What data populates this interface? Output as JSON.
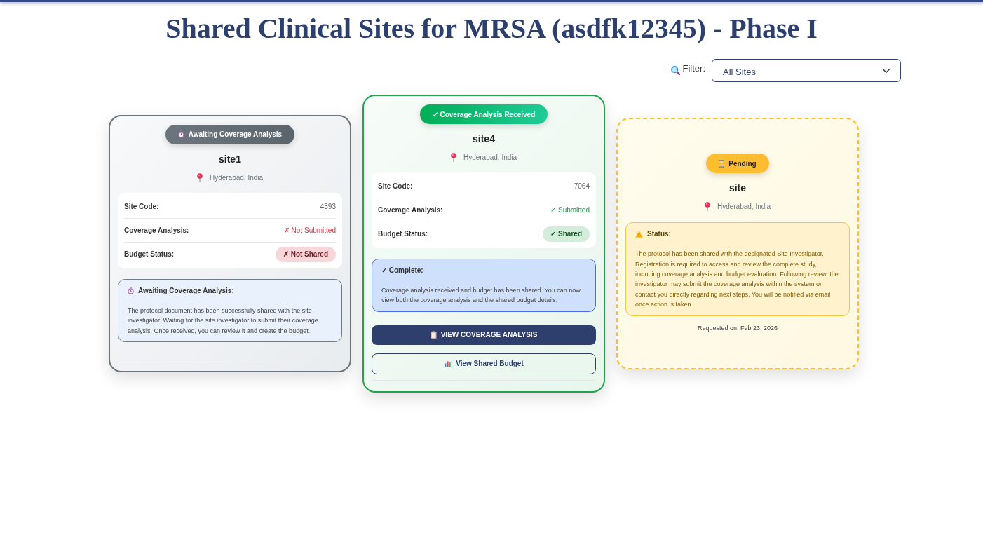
{
  "page_title": "Shared Clinical Sites for MRSA (asdfk12345) - Phase I",
  "filter": {
    "label": "Filter:",
    "value": "All Sites"
  },
  "sites": [
    {
      "kind": "awaiting",
      "status_badge": "Awaiting Coverage Analysis",
      "name": "site1",
      "location": "Hyderabad, India",
      "details": [
        {
          "label": "Site Code:",
          "value": "4393",
          "kind": "plain"
        },
        {
          "label": "Coverage Analysis:",
          "value": "✗ Not Submitted",
          "kind": "negative"
        },
        {
          "label": "Budget Status:",
          "value": "✗ Not Shared",
          "kind": "negative-pill"
        }
      ],
      "note": {
        "title": "Awaiting Coverage Analysis:",
        "text": "The protocol document has been successfully shared with the site investigator. Waiting for the site investigator to submit their coverage analysis. Once received, you can review it and create the budget."
      }
    },
    {
      "kind": "received",
      "status_badge": "✓ Coverage Analysis Received",
      "name": "site4",
      "location": "Hyderabad, India",
      "details": [
        {
          "label": "Site Code:",
          "value": "7064",
          "kind": "plain"
        },
        {
          "label": "Coverage Analysis:",
          "value": "✓ Submitted",
          "kind": "positive"
        },
        {
          "label": "Budget Status:",
          "value": "✓ Shared",
          "kind": "positive-pill"
        }
      ],
      "note": {
        "title": "✓ Complete:",
        "text": "Coverage analysis received and budget has been shared. You can now view both the coverage analysis and the shared budget details."
      },
      "actions": [
        {
          "label": "VIEW COVERAGE ANALYSIS",
          "kind": "primary"
        },
        {
          "label": "View Shared Budget",
          "kind": "outline"
        }
      ]
    },
    {
      "kind": "pending",
      "status_badge": "Pending",
      "name": "site",
      "location": "Hyderabad, India",
      "note": {
        "title": "Status:",
        "text": "The protocol has been shared with the designated Site Investigator. Registration is required to access and review the complete study, including coverage analysis and budget evaluation. Following review, the investigator may submit the coverage analysis within the system or contact you directly regarding next steps. You will be notified via email once action is taken."
      },
      "footer": "Requested on: Feb 23, 2026"
    }
  ]
}
